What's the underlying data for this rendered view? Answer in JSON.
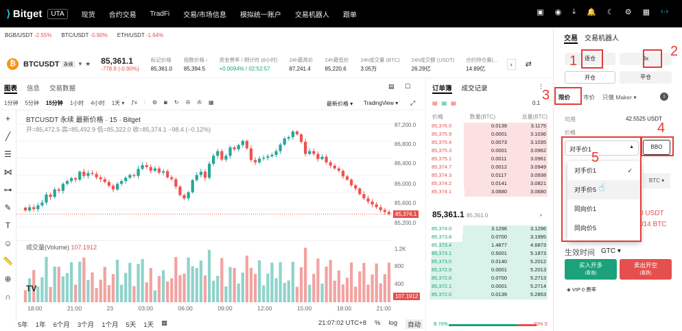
{
  "nav": {
    "logo": "Bitget",
    "uta": "UTA",
    "items": [
      "现货",
      "合约交易",
      "TradFi",
      "交易/市场信息",
      "模拟统一账户",
      "交易机器人",
      "跟单"
    ]
  },
  "ticker": [
    {
      "pair": "BGB/USDT",
      "chg": "-2.55%"
    },
    {
      "pair": "BTC/USDT",
      "chg": "-0.90%"
    },
    {
      "pair": "ETH/USDT",
      "chg": "-1.64%"
    }
  ],
  "header": {
    "symbol": "BTCUSDT",
    "tag": "永续",
    "price": "85,361.1",
    "change": "-778.9 (-0.90%)",
    "stats": [
      {
        "label": "标记价格",
        "value": "85,361.0"
      },
      {
        "label": "指数价格 ›",
        "value": "85,394.5"
      },
      {
        "label": "资金费率 / 倒计时 (8小时)",
        "value": "+0.0094% / 02:52:57"
      },
      {
        "label": "24h最高价",
        "value": "87,241.4"
      },
      {
        "label": "24h最低价",
        "value": "85,220.6"
      },
      {
        "label": "24h成交量 (BTC)",
        "value": "3.05万"
      },
      {
        "label": "24h成交额 (USDT)",
        "value": "26.29亿"
      },
      {
        "label": "合约持仓量(…",
        "value": "14.89亿"
      }
    ]
  },
  "chart_tabs": [
    "图表",
    "信息",
    "交易数据"
  ],
  "timeframes": [
    "1分钟",
    "5分钟",
    "15分钟",
    "1小时",
    "4小时",
    "1天 ▾"
  ],
  "chart_opts": [
    "最新价格 ▾",
    "TradingView ▾"
  ],
  "chart": {
    "title": "BTCUSDT 永续 最新价格 · 15 · Bitget",
    "ohlc": "开=85,472.5 高=85,492.9 低=85,322.0 收=85,374.1 −98.4 (−0.12%)",
    "vol_label": "成交量(Volume)",
    "vol_value": "107.1912",
    "last_tag": "85,374.1",
    "vol_tag": "107.1912",
    "y_ticks": [
      "87,200.0",
      "86,800.0",
      "86,400.0",
      "86,000.0",
      "85,600.0",
      "85,200.0"
    ],
    "vol_ticks": [
      "1.2K",
      "800",
      "400"
    ],
    "x_ticks": [
      "18:00",
      "21:00",
      "23",
      "03:00",
      "06:00",
      "09:00",
      "12:00",
      "15:00",
      "18:00",
      "21:00"
    ]
  },
  "chart_data": {
    "type": "candlestick",
    "title": "BTCUSDT 永续 最新价格 · 15 · Bitget",
    "ylim": [
      85100,
      87300
    ],
    "close": [
      85450,
      85520,
      85480,
      85560,
      85620,
      85790,
      85740,
      85900,
      85870,
      86020,
      86080,
      86140,
      86110,
      86280,
      86190,
      86250,
      86230,
      86160,
      86120,
      86060,
      85980,
      85900,
      86020,
      86080,
      86150,
      86210,
      86190,
      86340,
      86420,
      86380,
      86300,
      86350,
      86260,
      86290,
      86160,
      86120,
      85960,
      85780,
      85710,
      85840,
      86100,
      86210,
      86280,
      86150,
      86450,
      86620,
      86720,
      86540,
      86620,
      86800,
      86760,
      86850,
      86940,
      86780,
      86530,
      86480,
      86560,
      86580,
      86610,
      86640,
      86720,
      86860,
      86990,
      87020,
      87140,
      87080,
      86920,
      86660,
      86720,
      86660,
      86550,
      86600,
      86480,
      86410,
      86350,
      86300,
      86180,
      86110,
      85990,
      85920,
      85800,
      85710,
      85640,
      85580,
      85520,
      85460,
      85420,
      85374
    ]
  },
  "bottom": {
    "ranges": [
      "5年",
      "1年",
      "6个月",
      "3个月",
      "1个月",
      "5天",
      "1天"
    ],
    "time": "21:07:02 UTC+8",
    "pct": "%",
    "log": "log",
    "auto": "自动"
  },
  "orderbook": {
    "tabs": [
      "订单簿",
      "成交记录"
    ],
    "step": "0.1",
    "cols": [
      "价格",
      "数量(BTC)",
      "总量(BTC)"
    ],
    "asks": [
      [
        "85,376.0",
        "0.0139",
        "3.1175"
      ],
      [
        "85,375.9",
        "0.0001",
        "3.1036"
      ],
      [
        "85,375.4",
        "0.0073",
        "3.1035"
      ],
      [
        "85,375.3",
        "0.0001",
        "3.0962"
      ],
      [
        "85,375.1",
        "0.0011",
        "3.0961"
      ],
      [
        "85,374.7",
        "0.0012",
        "3.0949"
      ],
      [
        "85,374.3",
        "0.0117",
        "3.0938"
      ],
      [
        "85,374.2",
        "0.0141",
        "3.0821"
      ],
      [
        "85,374.1",
        "3.0680",
        "3.0680"
      ]
    ],
    "mid": "85,361.1",
    "mid_sub": "85,361.0",
    "bids": [
      [
        "85,374.0",
        "3.1296",
        "3.1296"
      ],
      [
        "85,373.8",
        "0.0700",
        "3.1995"
      ],
      [
        "85,373.4",
        "1.4877",
        "4.6873"
      ],
      [
        "85,373.1",
        "0.5001",
        "5.1873"
      ],
      [
        "85,373.0",
        "0.0140",
        "5.2012"
      ],
      [
        "85,372.9",
        "0.0001",
        "5.2013"
      ],
      [
        "85,372.8",
        "0.0700",
        "5.2713"
      ],
      [
        "85,372.1",
        "0.0001",
        "5.2714"
      ],
      [
        "85,372.0",
        "0.0139",
        "5.2853"
      ]
    ],
    "buy_pct": "B 70%",
    "sell_pct": "30% S"
  },
  "panel": {
    "tabs": [
      "交易",
      "交易机器人"
    ],
    "margin": "逐仓",
    "leverage": "3x",
    "open": "开仓",
    "close": "平仓",
    "limit": "限价",
    "market": "市价",
    "maker": "只做 Maker ▾",
    "avail_label": "可用",
    "avail": "42.5525 USDT",
    "price_label": "价格",
    "price_select": "对手价1",
    "bbo": "BBO",
    "unit": "BTC ▾",
    "partial1": "0 USDT",
    "partial2": "014 BTC",
    "tif": "生效时间",
    "gtc": "GTC ▾",
    "buy": "买入开多",
    "buy_sub": "(看涨)",
    "sell": "卖出开空",
    "sell_sub": "(看跌)",
    "vip": "VIP 0 费率"
  },
  "dropdown": [
    "对手价1",
    "对手价5",
    "同向价1",
    "同向价5"
  ],
  "annotations": [
    "1",
    "2",
    "3",
    "4",
    "5"
  ]
}
